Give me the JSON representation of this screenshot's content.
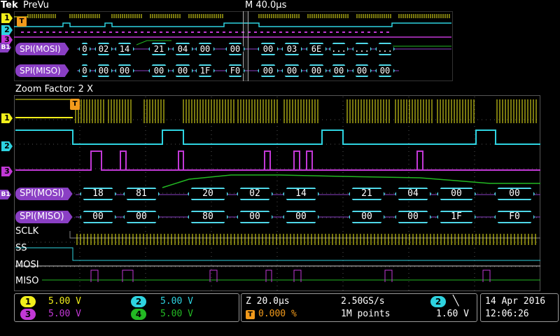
{
  "topbar": {
    "brand": "Tek",
    "mode": "PreVu",
    "timebase": "M 40.0µs"
  },
  "zoom": {
    "label": "Zoom Factor: 2 X"
  },
  "overview": {
    "mosi_label": "SPI(MOSI)",
    "miso_label": "SPI(MISO)",
    "mosi": [
      "0",
      "02",
      "14",
      "21",
      "04",
      "00",
      "00",
      "00",
      "03",
      "6E",
      "...",
      "...",
      "..."
    ],
    "miso": [
      "0",
      "00",
      "00",
      "00",
      "00",
      "1F",
      "F0",
      "00",
      "00",
      "00",
      "00",
      "00",
      "00"
    ],
    "markers": [
      "1",
      "2",
      "3",
      "B1"
    ]
  },
  "zoomview": {
    "markers": [
      "1",
      "2",
      "3",
      "B1"
    ],
    "mosi_label": "SPI(MOSI)",
    "miso_label": "SPI(MISO)",
    "mosi": [
      "18",
      "81",
      "20",
      "02",
      "14",
      "21",
      "04",
      "00",
      "00"
    ],
    "miso": [
      "00",
      "00",
      "80",
      "00",
      "00",
      "00",
      "00",
      "1F",
      "F0"
    ],
    "digital": [
      "SCLK",
      "SS",
      "MOSI",
      "MISO"
    ]
  },
  "status": {
    "ch1": {
      "num": "1",
      "scale": "5.00 V",
      "color": "#f2ef1b"
    },
    "ch2": {
      "num": "2",
      "scale": "5.00 V",
      "color": "#2ed3e0"
    },
    "ch3": {
      "num": "3",
      "scale": "5.00 V",
      "color": "#c238d6"
    },
    "ch4": {
      "num": "4",
      "scale": "5.00 V",
      "color": "#23b923"
    },
    "zoom_time": "Z 20.0µs",
    "trigger_pos": "0.000 %",
    "sample_rate": "2.50GS/s",
    "record_length": "1M points",
    "trig_channel": "2",
    "trig_level": "1.60 V",
    "date": "14 Apr 2016",
    "time": "12:06:26"
  }
}
